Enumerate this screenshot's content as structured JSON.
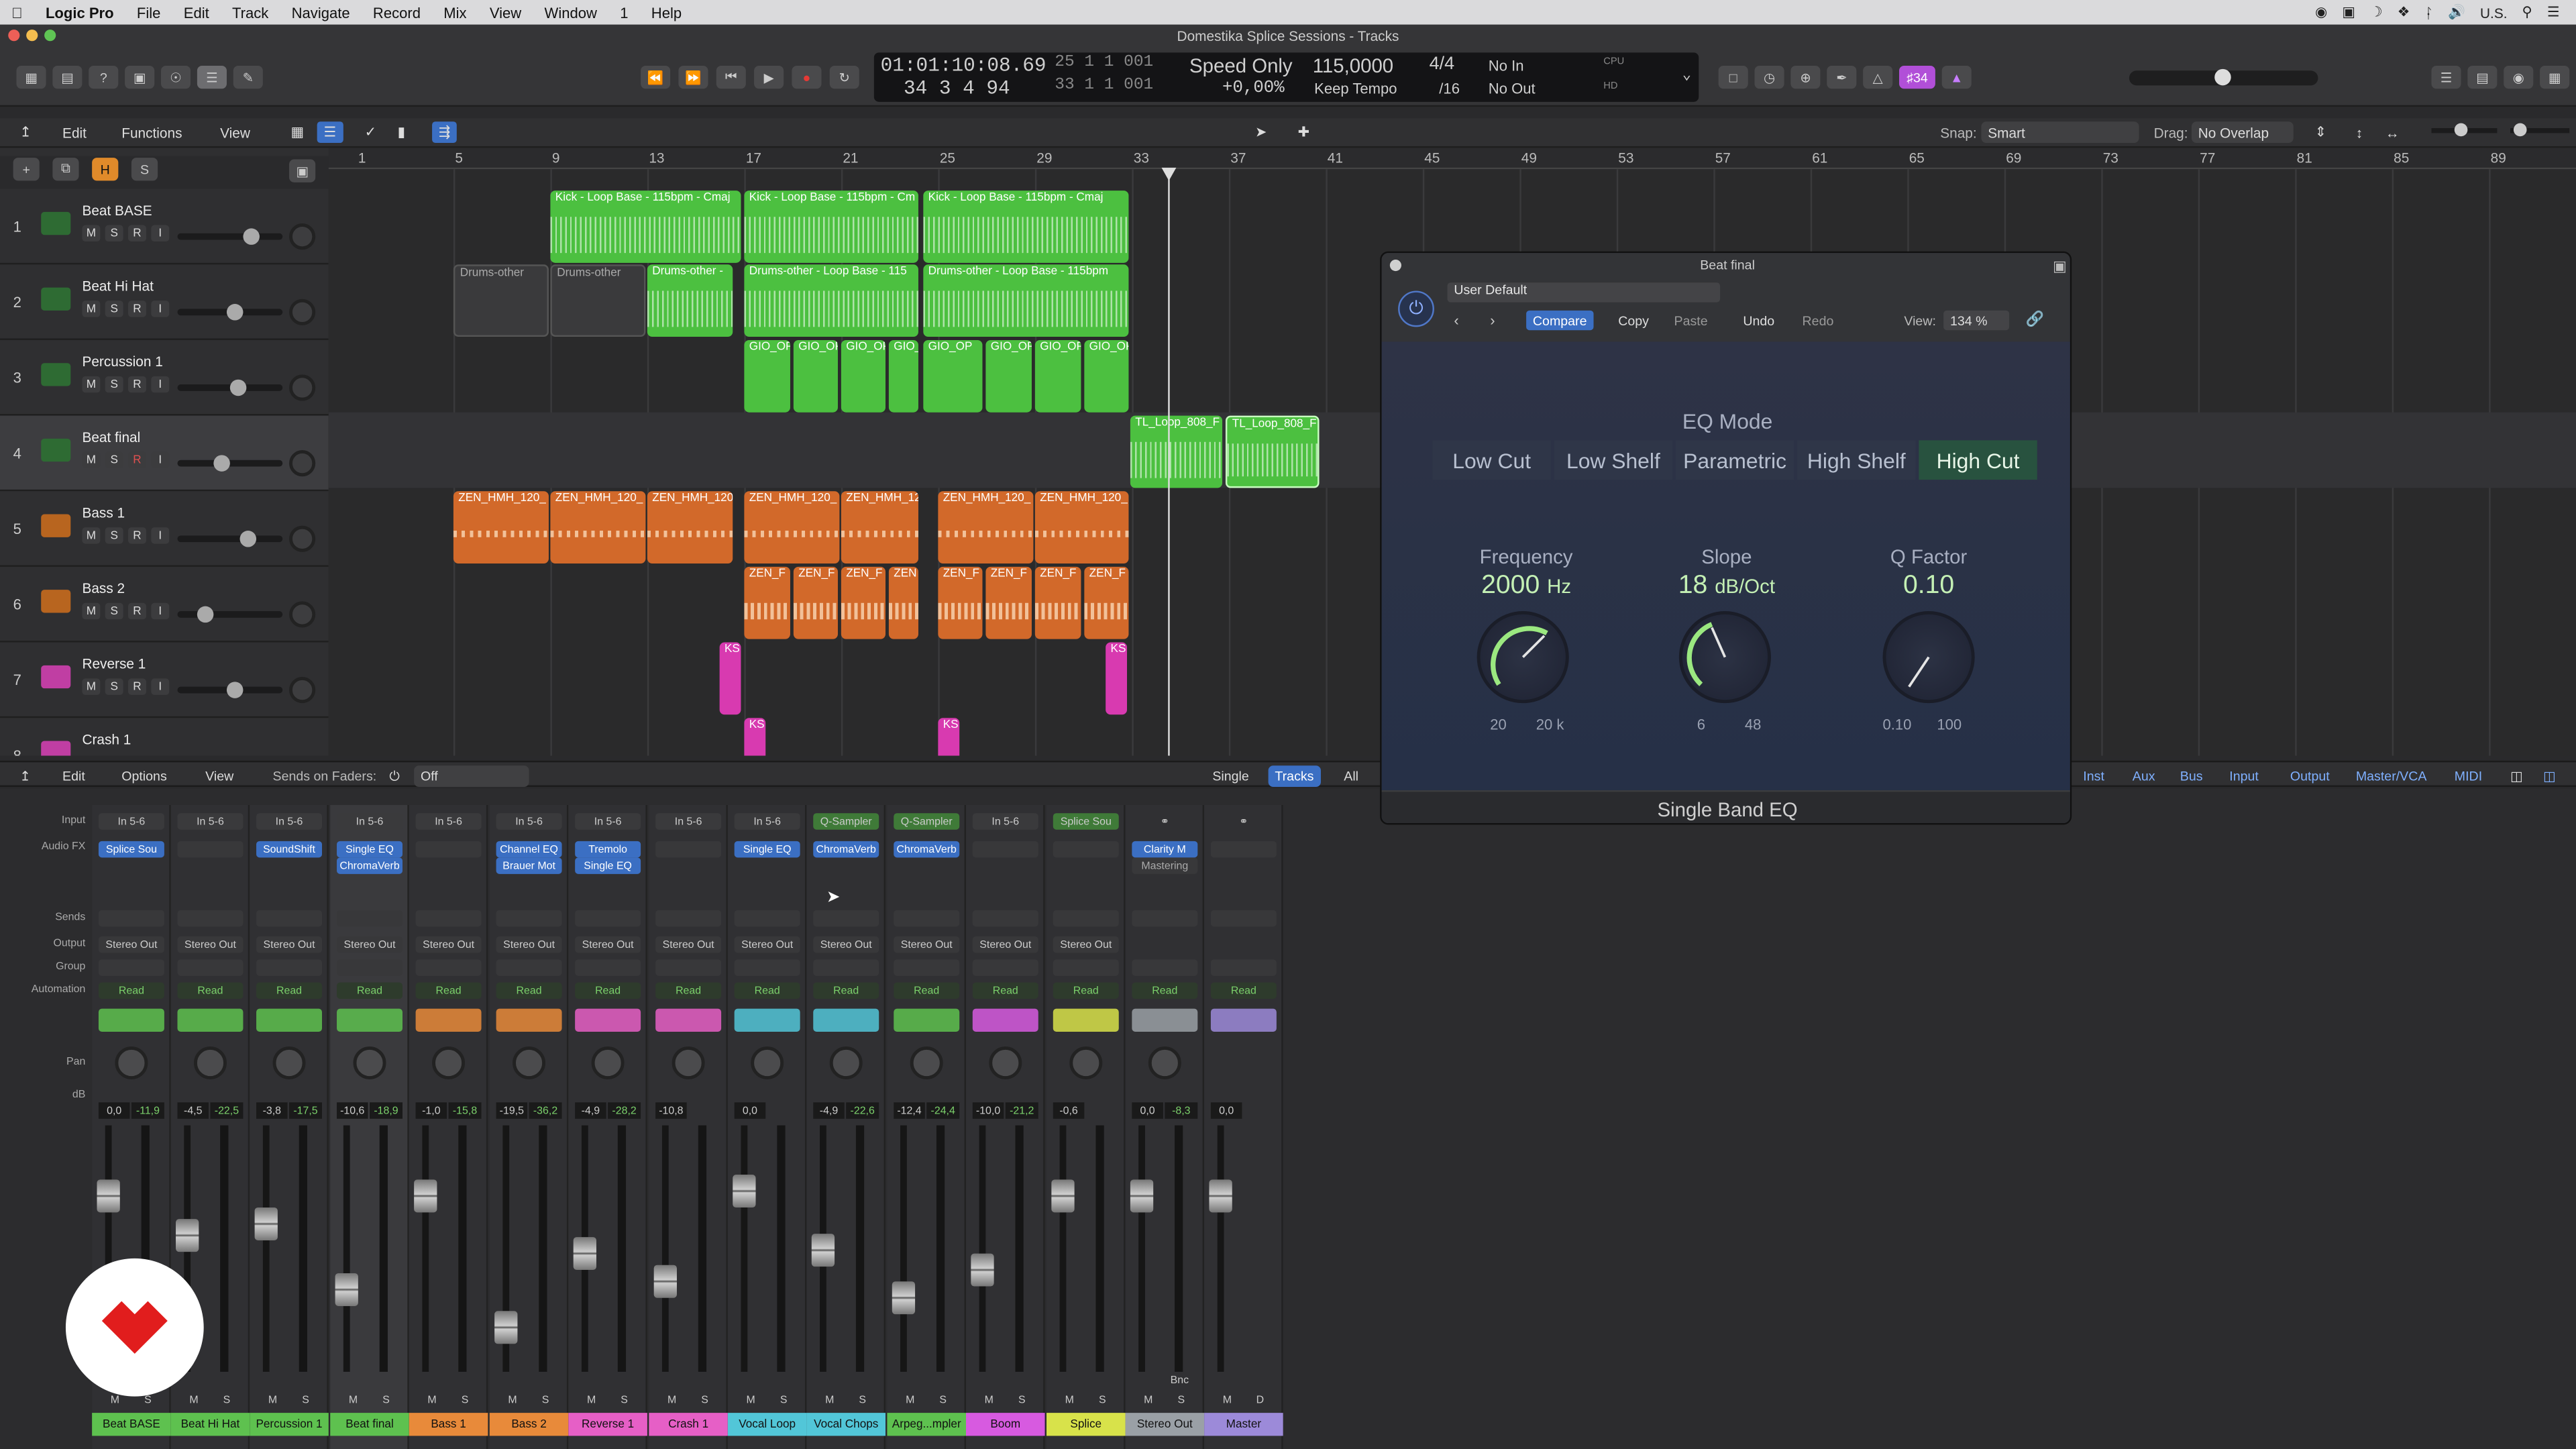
{
  "menubar": {
    "app": "Logic Pro",
    "items": [
      "File",
      "Edit",
      "Track",
      "Navigate",
      "Record",
      "Mix",
      "View",
      "Window",
      "1",
      "Help"
    ],
    "input_source": "U.S."
  },
  "window": {
    "title": "Domestika Splice Sessions - Tracks"
  },
  "lcd": {
    "time": "01:01:10:08.69",
    "bars": "34  3  4    94",
    "sub1": "25   1   1   001",
    "sub2": "33   1   1   001",
    "mode": "Speed Only",
    "percent": "+0,00%",
    "tempo": "115,0000",
    "keep_tempo": "Keep Tempo",
    "signature": "4/4",
    "division": "/16",
    "in": "No In",
    "out": "No Out",
    "cpu": "CPU",
    "hd": "HD",
    "badge": "♯34"
  },
  "arrange_bar": {
    "edit": "Edit",
    "functions": "Functions",
    "view": "View",
    "snap_label": "Snap:",
    "snap": "Smart",
    "drag_label": "Drag:",
    "drag": "No Overlap"
  },
  "header_buttons": {
    "h": "H",
    "s": "S"
  },
  "ruler": [
    "1",
    "5",
    "9",
    "13",
    "17",
    "21",
    "25",
    "29",
    "33",
    "37",
    "41",
    "45",
    "49",
    "53",
    "57",
    "61",
    "65",
    "69",
    "73",
    "77",
    "81",
    "85",
    "89"
  ],
  "tracks": [
    {
      "num": "1",
      "name": "Beat BASE",
      "color": "#3aa547"
    },
    {
      "num": "2",
      "name": "Beat Hi Hat",
      "color": "#3aa547"
    },
    {
      "num": "3",
      "name": "Percussion 1",
      "color": "#3aa547"
    },
    {
      "num": "4",
      "name": "Beat final",
      "color": "#3aa547"
    },
    {
      "num": "5",
      "name": "Bass 1",
      "color": "#e27a2a"
    },
    {
      "num": "6",
      "name": "Bass 2",
      "color": "#e27a2a"
    },
    {
      "num": "7",
      "name": "Reverse 1",
      "color": "#e04bb8"
    },
    {
      "num": "8",
      "name": "Crash 1",
      "color": "#e04bb8"
    }
  ],
  "track_buttons": {
    "m": "M",
    "s": "S",
    "r": "R",
    "i": "I"
  },
  "regions": {
    "kick1": "Kick - Loop Base - 115bpm - Cmaj",
    "kick2": "Kick - Loop Base - 115bpm - Cm",
    "kick3": "Kick - Loop Base - 115bpm - Cmaj",
    "drums1": "Drums-other",
    "drums2": "Drums-other",
    "drums3": "Drums-other -",
    "drums4": "Drums-other - Loop Base - 115",
    "drums5": "Drums-other - Loop Base - 115bpm",
    "gio": "GIO_OP",
    "tl1": "TL_Loop_808_F",
    "tl2": "TL_Loop_808_F",
    "zen": "ZEN_HMH_120_",
    "zenf": "ZEN_F",
    "zen2": "ZEN_HMH_12",
    "zen3": "ZEN",
    "ks": "KS"
  },
  "mixer_bar": {
    "edit": "Edit",
    "options": "Options",
    "view": "View",
    "sends_label": "Sends on Faders:",
    "sends_value": "Off",
    "single": "Single",
    "tracks": "Tracks",
    "all": "All",
    "filters": [
      "Inst",
      "Aux",
      "Bus",
      "Input",
      "Output",
      "Master/VCA",
      "MIDI"
    ]
  },
  "mixer_rows": {
    "input": "Input",
    "audio_fx": "Audio FX",
    "sends": "Sends",
    "output": "Output",
    "group": "Group",
    "automation": "Automation",
    "pan": "Pan",
    "db": "dB"
  },
  "strips": [
    {
      "name": "Beat BASE",
      "color": "#5ec14f",
      "input": "In 5-6",
      "fx1": "Splice Sou",
      "fx2": "",
      "output": "Stereo Out",
      "auto": "Read",
      "db1": "0,0",
      "db2": "-11,9"
    },
    {
      "name": "Beat Hi Hat",
      "color": "#5ec14f",
      "input": "In 5-6",
      "fx1": "",
      "fx2": "",
      "output": "Stereo Out",
      "auto": "Read",
      "db1": "-4,5",
      "db2": "-22,5"
    },
    {
      "name": "Percussion 1",
      "color": "#5ec14f",
      "input": "In 5-6",
      "fx1": "SoundShift",
      "fx2": "",
      "output": "Stereo Out",
      "auto": "Read",
      "db1": "-3,8",
      "db2": "-17,5"
    },
    {
      "name": "Beat final",
      "color": "#5ec14f",
      "input": "In 5-6",
      "fx1": "Single EQ",
      "fx2": "ChromaVerb",
      "output": "Stereo Out",
      "auto": "Read",
      "db1": "-10,6",
      "db2": "-18,9"
    },
    {
      "name": "Bass 1",
      "color": "#e88a3a",
      "input": "In 5-6",
      "fx1": "",
      "fx2": "",
      "output": "Stereo Out",
      "auto": "Read",
      "db1": "-1,0",
      "db2": "-15,8"
    },
    {
      "name": "Bass 2",
      "color": "#e88a3a",
      "input": "In 5-6",
      "fx1": "Channel EQ",
      "fx2": "Brauer Mot",
      "output": "Stereo Out",
      "auto": "Read",
      "db1": "-19,5",
      "db2": "-36,2"
    },
    {
      "name": "Reverse 1",
      "color": "#e65fc6",
      "input": "In 5-6",
      "fx1": "Tremolo",
      "fx2": "Single EQ",
      "output": "Stereo Out",
      "auto": "Read",
      "db1": "-4,9",
      "db2": "-28,2"
    },
    {
      "name": "Crash 1",
      "color": "#e65fc6",
      "input": "In 5-6",
      "fx1": "",
      "fx2": "",
      "output": "Stereo Out",
      "auto": "Read",
      "db1": "-10,8",
      "db2": ""
    },
    {
      "name": "Vocal Loop",
      "color": "#52c6d8",
      "input": "In 5-6",
      "fx1": "Single EQ",
      "fx2": "",
      "output": "Stereo Out",
      "auto": "Read",
      "db1": "0,0",
      "db2": ""
    },
    {
      "name": "Vocal Chops",
      "color": "#52c6d8",
      "input": "Q-Sampler",
      "fx1": "ChromaVerb",
      "fx2": "",
      "output": "Stereo Out",
      "auto": "Read",
      "db1": "-4,9",
      "db2": "-22,6"
    },
    {
      "name": "Arpeg...mpler",
      "color": "#5ec14f",
      "input": "Q-Sampler",
      "fx1": "ChromaVerb",
      "fx2": "",
      "output": "Stereo Out",
      "auto": "Read",
      "db1": "-12,4",
      "db2": "-24,4"
    },
    {
      "name": "Boom",
      "color": "#d75ae0",
      "input": "In 5-6",
      "fx1": "",
      "fx2": "",
      "output": "Stereo Out",
      "auto": "Read",
      "db1": "-10,0",
      "db2": "-21,2"
    },
    {
      "name": "Splice",
      "color": "#d8e24a",
      "input": "Splice Sou",
      "fx1": "",
      "fx2": "",
      "output": "Stereo Out",
      "auto": "Read",
      "db1": "-0,6",
      "db2": ""
    },
    {
      "name": "Stereo Out",
      "color": "#9aa0a6",
      "input": "",
      "fx1": "Clarity M",
      "fx2": "Mastering",
      "output": "",
      "auto": "Read",
      "db1": "0,0",
      "db2": "-8,3"
    },
    {
      "name": "Master",
      "color": "#9c8ad9",
      "input": "",
      "fx1": "",
      "fx2": "",
      "output": "",
      "auto": "Read",
      "db1": "0,0",
      "db2": ""
    }
  ],
  "strip_extra": {
    "bnc": "Bnc",
    "d": "D",
    "r": "R",
    "i": "I"
  },
  "plugin": {
    "title": "Beat final",
    "preset": "User Default",
    "compare": "Compare",
    "copy": "Copy",
    "paste": "Paste",
    "undo": "Undo",
    "redo": "Redo",
    "view_label": "View:",
    "view_value": "134 %",
    "eq_mode_label": "EQ Mode",
    "modes": [
      "Low Cut",
      "Low Shelf",
      "Parametric",
      "High Shelf",
      "High Cut"
    ],
    "selected_mode": "High Cut",
    "frequency_label": "Frequency",
    "frequency_value": "2000",
    "frequency_unit": "Hz",
    "freq_min": "20",
    "freq_max": "20 k",
    "slope_label": "Slope",
    "slope_value": "18",
    "slope_unit": "dB/Oct",
    "slope_min": "6",
    "slope_max": "48",
    "q_label": "Q Factor",
    "q_value": "0.10",
    "q_min": "0.10",
    "q_max": "100",
    "name": "Single Band EQ"
  }
}
